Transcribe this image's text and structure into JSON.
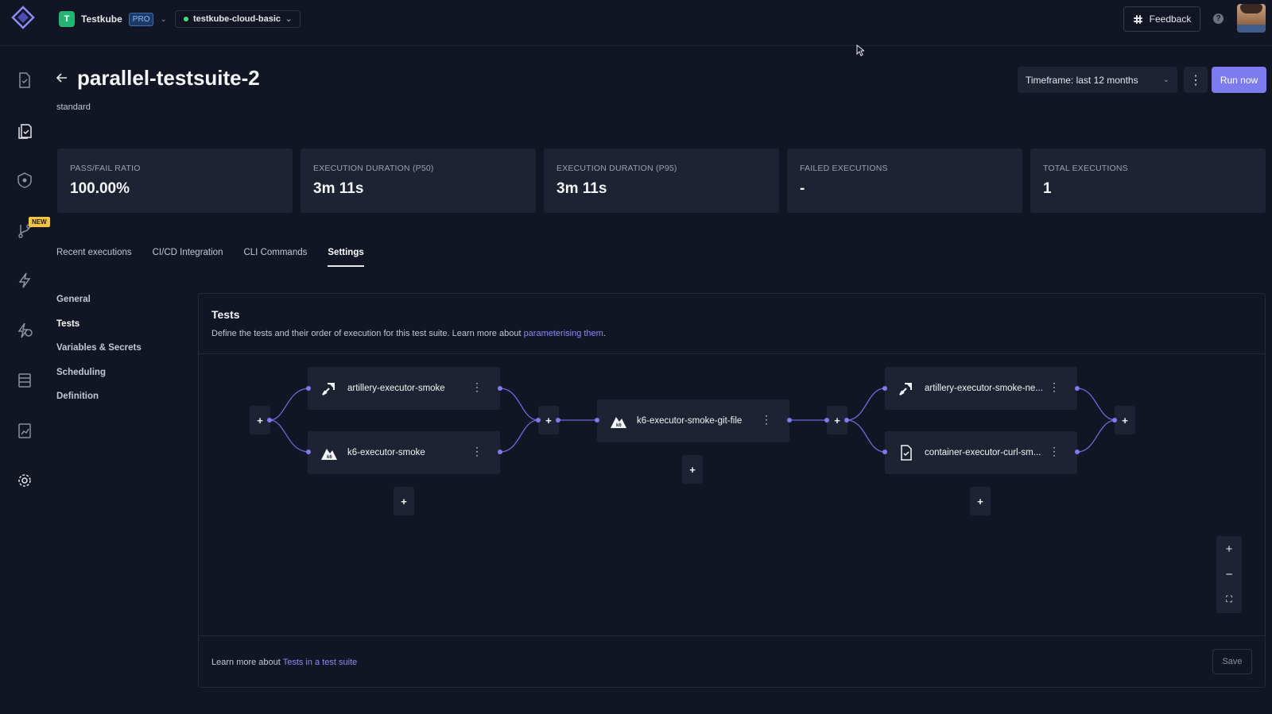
{
  "topbar": {
    "org_initial": "T",
    "org_name": "Testkube",
    "plan_badge": "PRO",
    "environment": "testkube-cloud-basic",
    "feedback_label": "Feedback",
    "help_icon": "?"
  },
  "sidebar": {
    "new_badge": "NEW"
  },
  "header": {
    "title": "parallel-testsuite-2",
    "subtitle": "standard",
    "timeframe_label": "Timeframe: last 12 months",
    "run_label": "Run now"
  },
  "metrics": [
    {
      "label": "PASS/FAIL RATIO",
      "value": "100.00%"
    },
    {
      "label": "EXECUTION DURATION (P50)",
      "value": "3m 11s"
    },
    {
      "label": "EXECUTION DURATION (P95)",
      "value": "3m 11s"
    },
    {
      "label": "FAILED EXECUTIONS",
      "value": "-"
    },
    {
      "label": "TOTAL EXECUTIONS",
      "value": "1"
    }
  ],
  "tabs": [
    {
      "label": "Recent executions"
    },
    {
      "label": "CI/CD Integration"
    },
    {
      "label": "CLI Commands"
    },
    {
      "label": "Settings",
      "active": true
    }
  ],
  "settings_nav": [
    {
      "label": "General"
    },
    {
      "label": "Tests",
      "active": true
    },
    {
      "label": "Variables & Secrets"
    },
    {
      "label": "Scheduling"
    },
    {
      "label": "Definition"
    }
  ],
  "panel": {
    "title": "Tests",
    "description": "Define the tests and their order of execution for this test suite. Learn more about ",
    "description_link": "parameterising them",
    "description_end": ".",
    "footer_text": "Learn more about ",
    "footer_link": "Tests in a test suite",
    "save_label": "Save"
  },
  "graph": {
    "plus_symbol": "+",
    "menu_symbol": "⋮",
    "nodes": [
      {
        "label": "artillery-executor-smoke",
        "icon": "artillery-icon"
      },
      {
        "label": "k6-executor-smoke",
        "icon": "k6-icon"
      },
      {
        "label": "k6-executor-smoke-git-file",
        "icon": "k6-icon"
      },
      {
        "label": "artillery-executor-smoke-ne...",
        "icon": "artillery-icon"
      },
      {
        "label": "container-executor-curl-sm...",
        "icon": "file-icon"
      }
    ]
  },
  "zoom": {
    "zoom_in": "+",
    "zoom_out": "−",
    "fit": "⛶"
  },
  "colors": {
    "background": "#111524",
    "card": "#1e2333",
    "accent": "#7c7cf0",
    "link": "#8b8bf5"
  }
}
